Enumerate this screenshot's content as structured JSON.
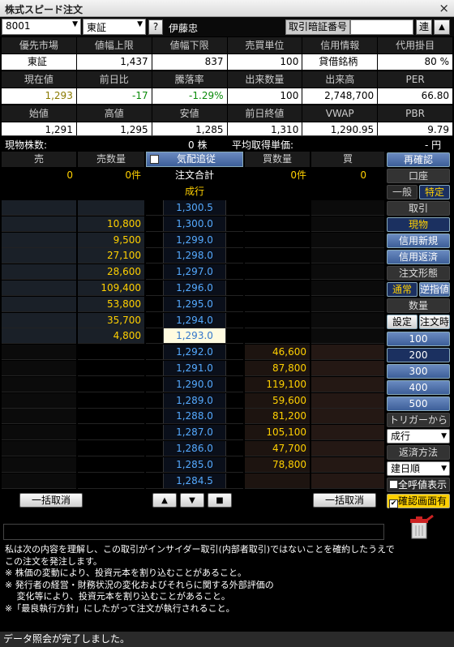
{
  "window": {
    "title": "株式スピード注文",
    "close": "×"
  },
  "toolbar": {
    "code": "8001",
    "market": "東証",
    "help": "?",
    "name": "伊藤忠",
    "pin_label": "取引暗証番号",
    "pin_value": "",
    "link": "連",
    "up": "▲"
  },
  "info_row1": {
    "headers": [
      "優先市場",
      "値幅上限",
      "値幅下限",
      "売買単位",
      "信用情報",
      "代用掛目"
    ],
    "values": [
      "東証",
      "1,437",
      "837",
      "100",
      "貸借銘柄",
      "80 %"
    ]
  },
  "info_row2": {
    "headers": [
      "現在値",
      "前日比",
      "騰落率",
      "出来数量",
      "出来高",
      "PER"
    ],
    "values": [
      "1,293",
      "-17",
      "-1.29%",
      "100",
      "2,748,700",
      "66.80"
    ]
  },
  "info_row3": {
    "headers": [
      "始値",
      "高値",
      "安値",
      "前日終値",
      "VWAP",
      "PBR"
    ],
    "values": [
      "1,291",
      "1,295",
      "1,285",
      "1,310",
      "1,290.95",
      "9.79"
    ]
  },
  "holdings": {
    "label": "現物株数:",
    "value": "0 株",
    "avg_label": "平均取得単価:",
    "avg_value": "- 円"
  },
  "board": {
    "headers": {
      "sell": "売",
      "sell_qty": "売数量",
      "follow": "気配追従",
      "buy_qty": "買数量",
      "buy": "買"
    },
    "totals": {
      "sell": "0",
      "sell_qty": "0件",
      "order_total": "注文合計",
      "buy_qty": "0件",
      "buy": "0"
    },
    "market_label": "成行",
    "rows": [
      {
        "ask": "",
        "price": "1,300.5",
        "bid": ""
      },
      {
        "ask": "10,800",
        "price": "1,300.0",
        "bid": ""
      },
      {
        "ask": "9,500",
        "price": "1,299.0",
        "bid": ""
      },
      {
        "ask": "27,100",
        "price": "1,298.0",
        "bid": ""
      },
      {
        "ask": "28,600",
        "price": "1,297.0",
        "bid": ""
      },
      {
        "ask": "109,400",
        "price": "1,296.0",
        "bid": ""
      },
      {
        "ask": "53,800",
        "price": "1,295.0",
        "bid": ""
      },
      {
        "ask": "35,700",
        "price": "1,294.0",
        "bid": ""
      },
      {
        "ask": "4,800",
        "price": "1,293.0",
        "bid": ""
      },
      {
        "ask": "",
        "price": "1,292.0",
        "bid": "46,600"
      },
      {
        "ask": "",
        "price": "1,291.0",
        "bid": "87,800"
      },
      {
        "ask": "",
        "price": "1,290.0",
        "bid": "119,100"
      },
      {
        "ask": "",
        "price": "1,289.0",
        "bid": "59,600"
      },
      {
        "ask": "",
        "price": "1,288.0",
        "bid": "81,200"
      },
      {
        "ask": "",
        "price": "1,287.0",
        "bid": "105,100"
      },
      {
        "ask": "",
        "price": "1,286.0",
        "bid": "47,700"
      },
      {
        "ask": "",
        "price": "1,285.0",
        "bid": "78,800"
      },
      {
        "ask": "",
        "price": "1,284.5",
        "bid": ""
      }
    ],
    "cancel_all_sell": "一括取消",
    "cancel_all_buy": "一括取消",
    "nav_up": "▲",
    "nav_down": "▼",
    "nav_stop": "■"
  },
  "right_panel": {
    "reconfirm": "再確認",
    "account_label": "口座",
    "general": "一般",
    "specific": "特定",
    "trade_label": "取引",
    "spot": "現物",
    "margin_new": "信用新規",
    "margin_close": "信用返済",
    "order_type_label": "注文形態",
    "normal": "通常",
    "stop": "逆指値",
    "qty_label": "数量",
    "set": "設定",
    "at_order": "注文時",
    "qty_buttons": [
      "100",
      "200",
      "300",
      "400",
      "500"
    ],
    "trigger_label": "トリガーから",
    "trigger_value": "成行",
    "repay_label": "返済方法",
    "repay_value": "建日順",
    "show_all": "全呼値表示",
    "confirm_screen": "確認画面有"
  },
  "notice": {
    "lines": [
      "私は次の内容を理解し、この取引がインサイダー取引(内部者取引)ではないことを確約したうえで",
      "この注文を発注します。",
      "※ 株価の変動により、投資元本を割り込むことがあること。",
      "※ 発行者の経営・財務状況の変化およびそれらに関する外部評価の",
      "　 変化等により、投資元本を割り込むことがあること。",
      "※「最良執行方針」にしたがって注文が執行されること。"
    ]
  },
  "status": "データ照会が完了しました。",
  "colors": {
    "accent_blue": "#3d5f99",
    "price_blue": "#55aaff",
    "ask_yellow": "#ffd000",
    "current_bg": "#fffbe0"
  }
}
